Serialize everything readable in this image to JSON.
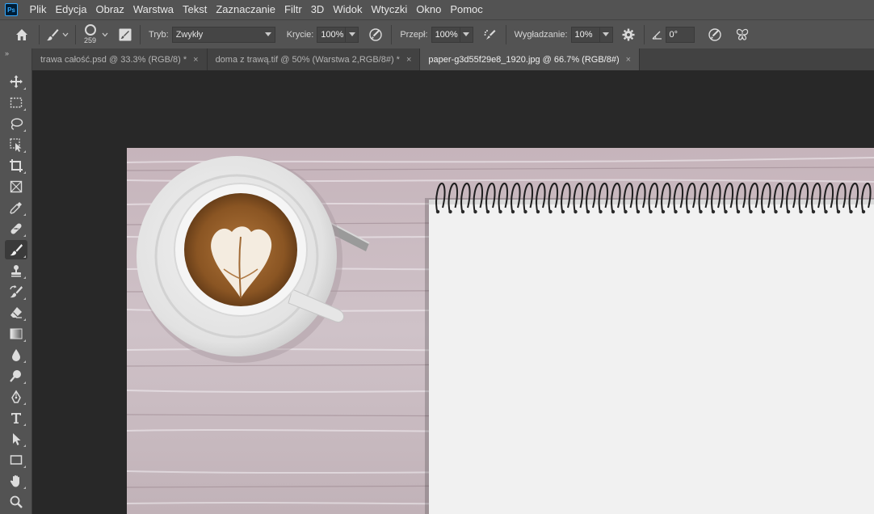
{
  "app": {
    "logo_text": "Ps"
  },
  "menu": [
    "Plik",
    "Edycja",
    "Obraz",
    "Warstwa",
    "Tekst",
    "Zaznaczanie",
    "Filtr",
    "3D",
    "Widok",
    "Wtyczki",
    "Okno",
    "Pomoc"
  ],
  "options": {
    "brush_size": "259",
    "mode_label": "Tryb:",
    "mode_value": "Zwykły",
    "opacity_label": "Krycie:",
    "opacity_value": "100%",
    "flow_label": "Przepł:",
    "flow_value": "100%",
    "smoothing_label": "Wygładzanie:",
    "smoothing_value": "10%",
    "angle_value": "0°"
  },
  "tabs": [
    {
      "label": "trawa całość.psd @ 33.3% (RGB/8) *",
      "active": false
    },
    {
      "label": "doma z trawą.tif @ 50% (Warstwa 2,RGB/8#) *",
      "active": false
    },
    {
      "label": "paper-g3d55f29e8_1920.jpg @ 66.7% (RGB/8#)",
      "active": true
    }
  ],
  "tab_close": "×",
  "toolbar_collapse": "»",
  "colors": {
    "accent": "#31a8ff",
    "panel": "#535353",
    "canvas_bg": "#282828"
  }
}
